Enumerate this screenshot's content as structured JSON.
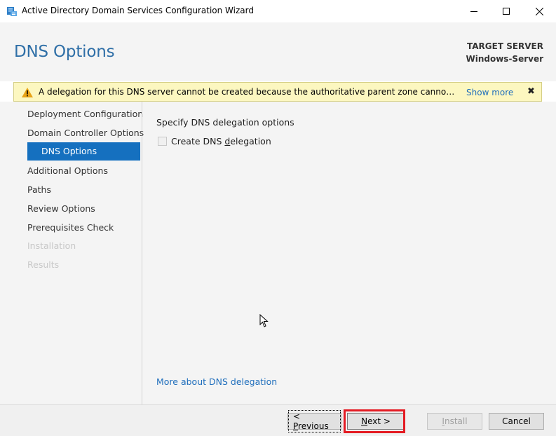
{
  "window": {
    "title": "Active Directory Domain Services Configuration Wizard",
    "icon": "server-manager-icon",
    "controls": [
      "minimize-icon",
      "maximize-icon",
      "close-icon"
    ]
  },
  "header": {
    "page_title": "DNS Options",
    "target_label": "TARGET SERVER",
    "target_name": "Windows-Server"
  },
  "warning": {
    "icon": "warning-icon",
    "text": "A delegation for this DNS server cannot be created because the authoritative parent zone cannot be found...",
    "link": "Show more",
    "close": "✖"
  },
  "nav": {
    "items": [
      {
        "label": "Deployment Configuration",
        "state": "normal"
      },
      {
        "label": "Domain Controller Options",
        "state": "normal"
      },
      {
        "label": "DNS Options",
        "state": "active"
      },
      {
        "label": "Additional Options",
        "state": "normal"
      },
      {
        "label": "Paths",
        "state": "normal"
      },
      {
        "label": "Review Options",
        "state": "normal"
      },
      {
        "label": "Prerequisites Check",
        "state": "normal"
      },
      {
        "label": "Installation",
        "state": "disabled"
      },
      {
        "label": "Results",
        "state": "disabled"
      }
    ]
  },
  "main": {
    "section_label": "Specify DNS delegation options",
    "checkbox": {
      "label_pre": "Create DNS ",
      "label_accel": "d",
      "label_post": "elegation",
      "checked": false
    },
    "more_link": "More about DNS delegation"
  },
  "footer": {
    "prev": {
      "accel": "P",
      "rest": "revious",
      "prefix": "< "
    },
    "next": {
      "accel": "N",
      "rest": "ext",
      "suffix": " >"
    },
    "install": {
      "accel": "I",
      "rest": "nstall"
    },
    "cancel": "Cancel"
  },
  "colors": {
    "accent": "#1570bf",
    "title": "#2f6fa7",
    "link": "#1f6ebc",
    "warning_bg": "#fcf7c0",
    "highlight": "#e41b23"
  }
}
